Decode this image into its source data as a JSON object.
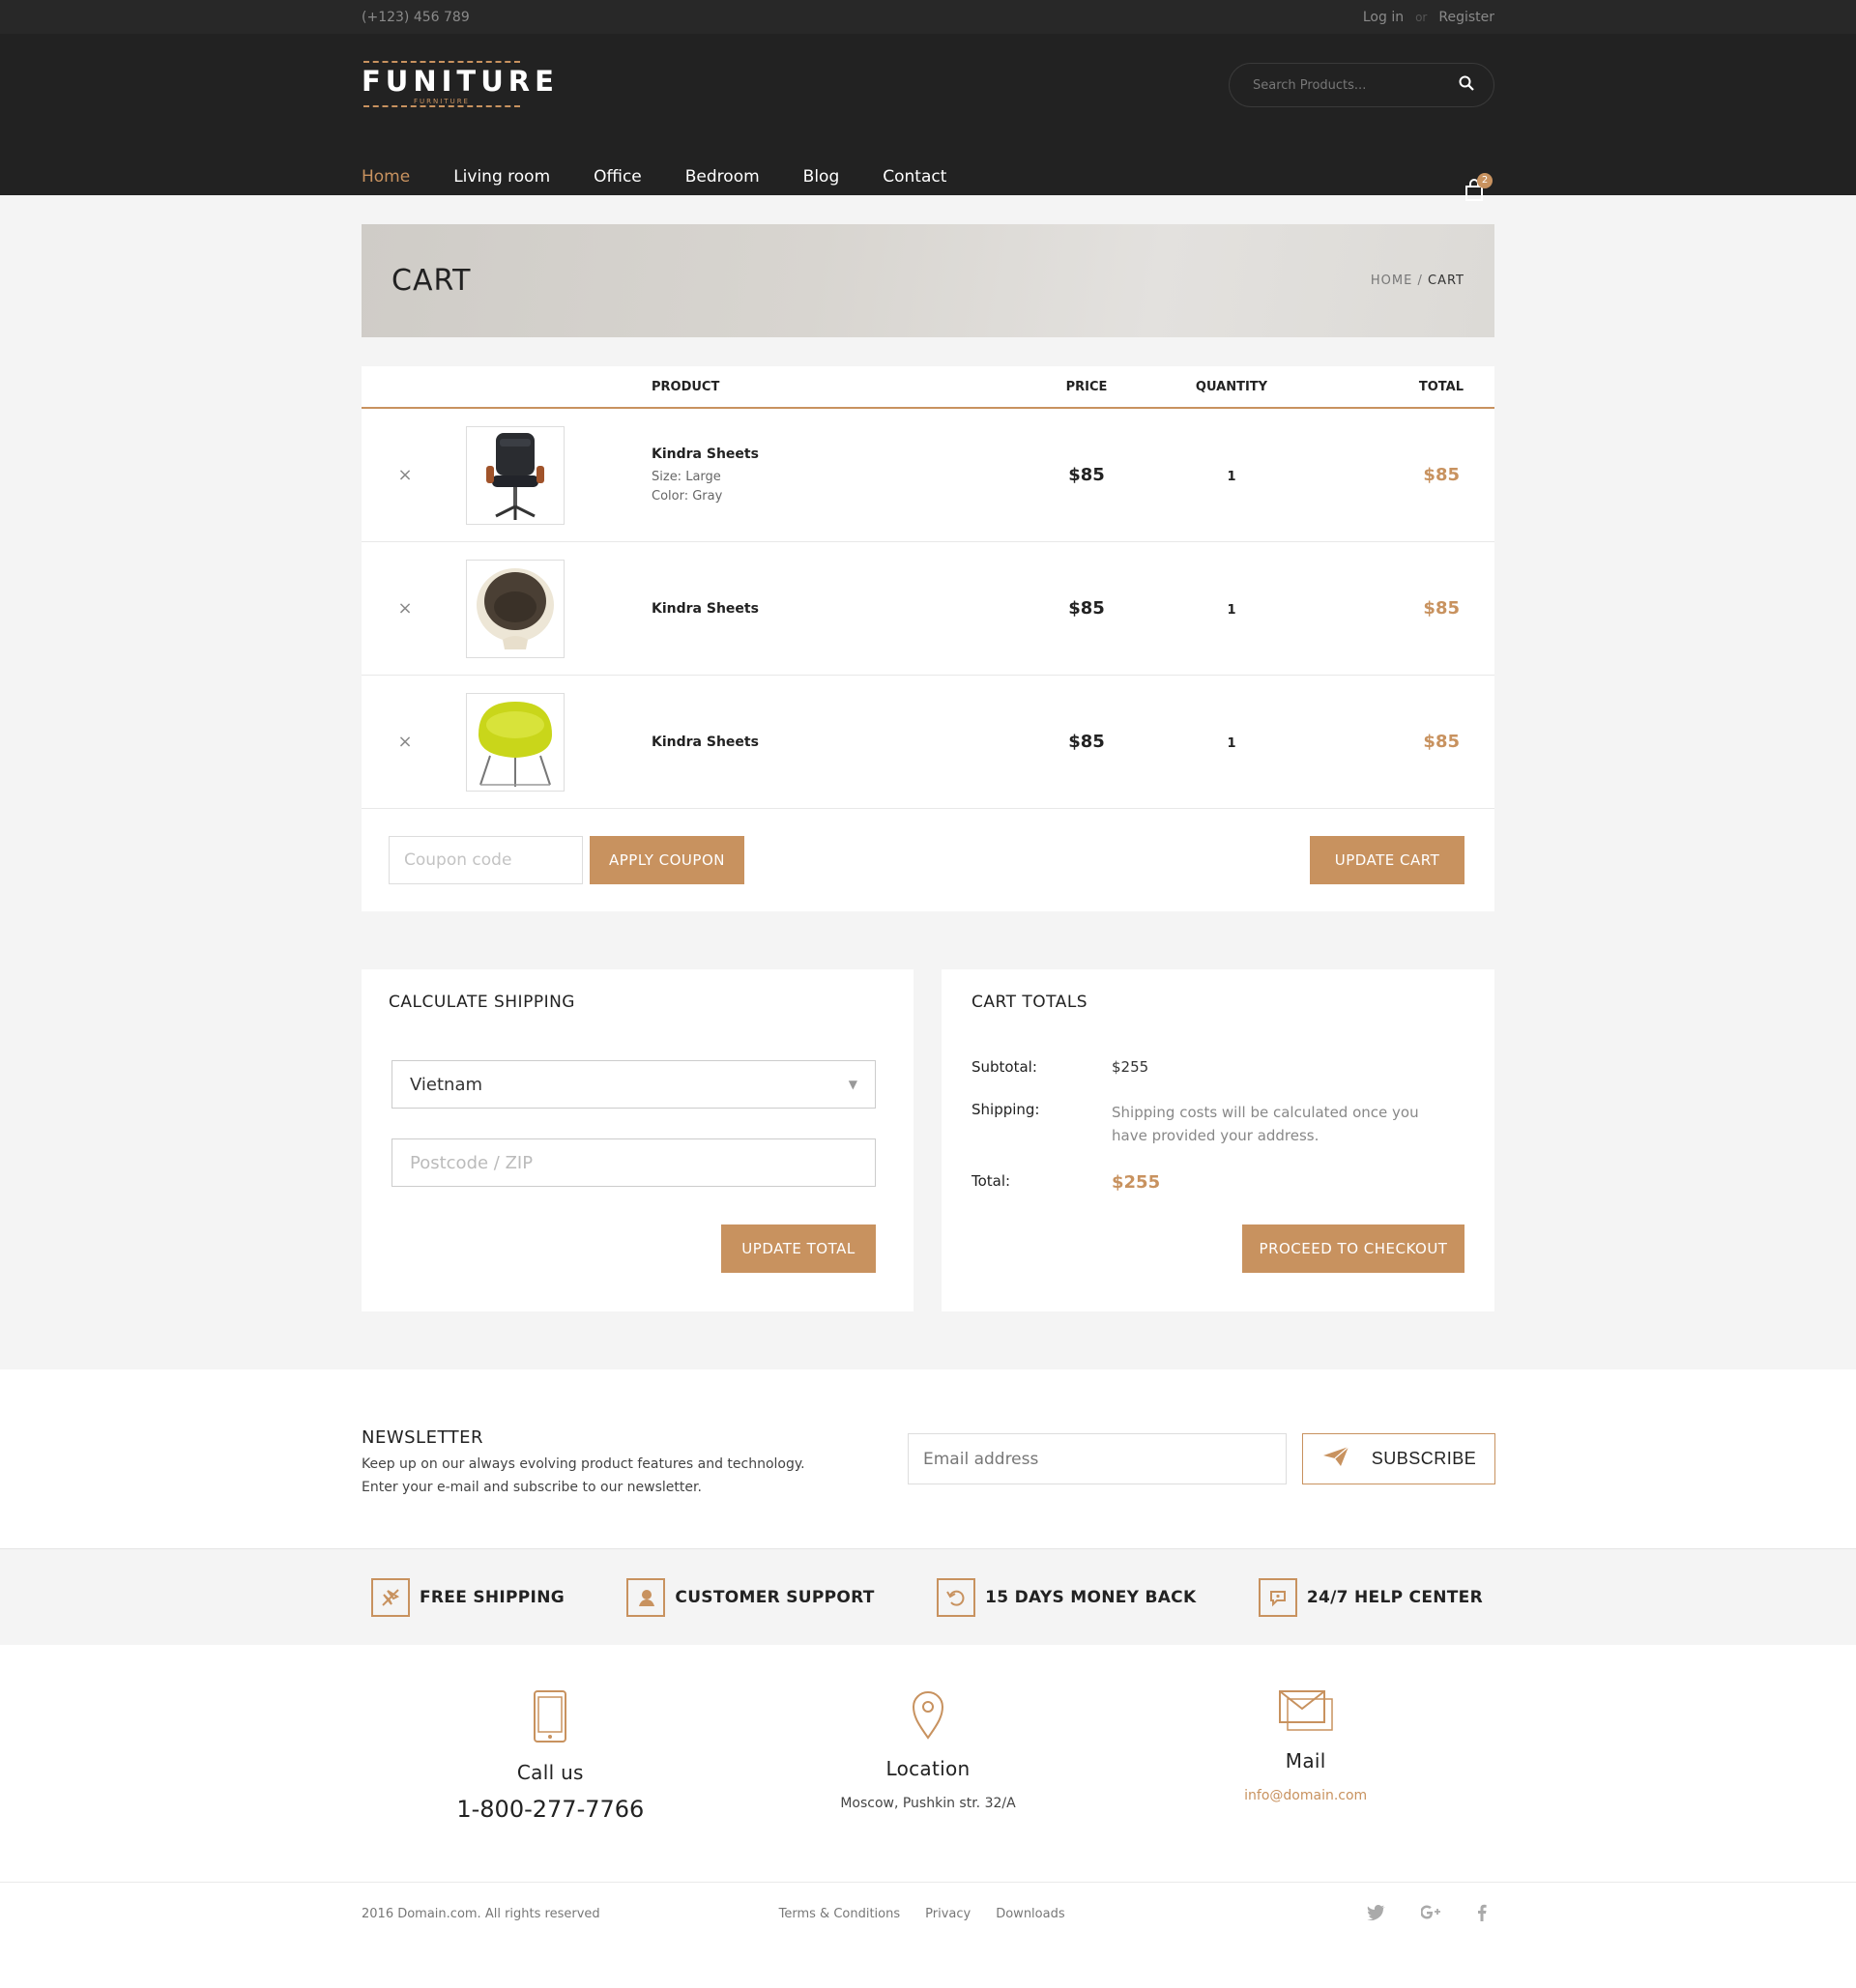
{
  "topbar": {
    "phone": "(+123) 456 789",
    "login": "Log in",
    "or": "or",
    "register": "Register"
  },
  "header": {
    "logo_word": "FUNITURE",
    "logo_sub": "FURNITURE",
    "search_placeholder": "Search Products...",
    "cart_count": "2",
    "nav": [
      "Home",
      "Living room",
      "Office",
      "Bedroom",
      "Blog",
      "Contact"
    ]
  },
  "banner": {
    "title": "CART",
    "crumb_home": "HOME",
    "crumb_sep": "/",
    "crumb_current": "CART"
  },
  "cart_table": {
    "headers": {
      "product": "PRODUCT",
      "price": "PRICE",
      "quantity": "QUANTITY",
      "total": "TOTAL"
    },
    "rows": [
      {
        "remove": "×",
        "name": "Kindra Sheets",
        "size": "Size: Large",
        "color": "Color: Gray",
        "price": "$85",
        "qty": "1",
        "total": "$85"
      },
      {
        "remove": "×",
        "name": "Kindra Sheets",
        "price": "$85",
        "qty": "1",
        "total": "$85"
      },
      {
        "remove": "×",
        "name": "Kindra Sheets",
        "price": "$85",
        "qty": "1",
        "total": "$85"
      }
    ],
    "coupon_placeholder": "Coupon code",
    "apply_coupon": "APPLY COUPON",
    "update_cart": "UPDATE CART"
  },
  "shipping": {
    "title": "CALCULATE SHIPPING",
    "country": "Vietnam",
    "zip_placeholder": "Postcode / ZIP",
    "update_total": "UPDATE TOTAL"
  },
  "totals": {
    "title": "CART TOTALS",
    "subtotal_label": "Subtotal:",
    "subtotal_value": "$255",
    "shipping_label": "Shipping:",
    "shipping_value": "Shipping costs will be calculated once you have provided your address.",
    "total_label": "Total:",
    "total_value": "$255",
    "checkout": "PROCEED TO CHECKOUT"
  },
  "newsletter": {
    "title": "NEWSLETTER",
    "line1": "Keep up on our always evolving product features and technology.",
    "line2": "Enter your e-mail and subscribe to our newsletter.",
    "email_placeholder": "Email address",
    "subscribe": "SUBSCRIBE"
  },
  "features": [
    "FREE SHIPPING",
    "CUSTOMER SUPPORT",
    "15 DAYS MONEY BACK",
    "24/7 HELP CENTER"
  ],
  "contact": {
    "call_title": "Call us",
    "call_value": "1-800-277-7766",
    "location_title": "Location",
    "location_value": "Moscow, Pushkin str. 32/A",
    "mail_title": "Mail",
    "mail_value": "info@domain.com"
  },
  "footer": {
    "copyright": "2016 Domain.com. All rights reserved",
    "links": [
      "Terms & Conditions",
      "Privacy",
      "Downloads"
    ]
  },
  "colors": {
    "accent": "#c8925f",
    "dark": "#222222",
    "topbar": "#282828",
    "bg": "#f4f4f4"
  }
}
